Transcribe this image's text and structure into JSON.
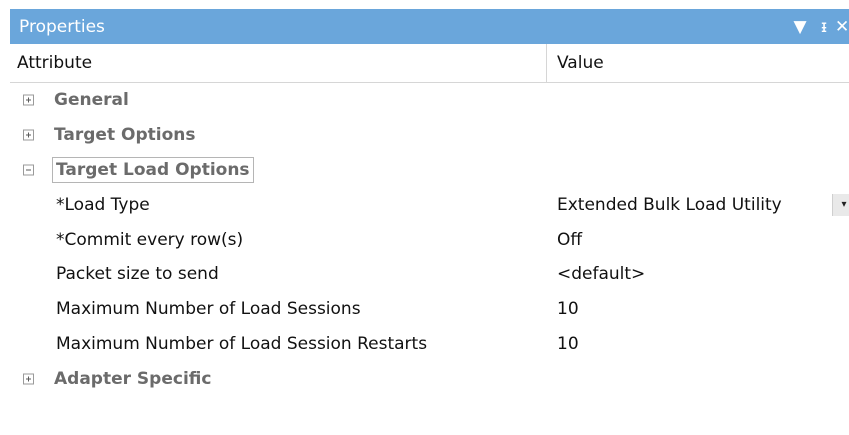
{
  "panel": {
    "title": "Properties",
    "controls": {
      "dropdown_glyph": "▼",
      "pin_glyph": "ᵻ",
      "close_glyph": "✕"
    }
  },
  "header": {
    "attribute_label": "Attribute",
    "value_label": "Value"
  },
  "groups": [
    {
      "label": "General",
      "expanded": false
    },
    {
      "label": "Target Options",
      "expanded": false
    },
    {
      "label": "Target Load Options",
      "expanded": true
    },
    {
      "label": "Adapter Specific",
      "expanded": false
    }
  ],
  "properties": [
    {
      "name": "*Load Type",
      "value": "Extended Bulk Load Utility",
      "has_dropdown": true
    },
    {
      "name": "*Commit every row(s)",
      "value": "Off"
    },
    {
      "name": "Packet size to send",
      "value": "<default>"
    },
    {
      "name": "Maximum Number of Load Sessions",
      "value": "10"
    },
    {
      "name": "Maximum Number of Load Session Restarts",
      "value": "10"
    }
  ],
  "dropdown_arrow": "▾",
  "colors": {
    "titlebar_bg": "#6aa6db",
    "group_text": "#6b6b6b"
  }
}
